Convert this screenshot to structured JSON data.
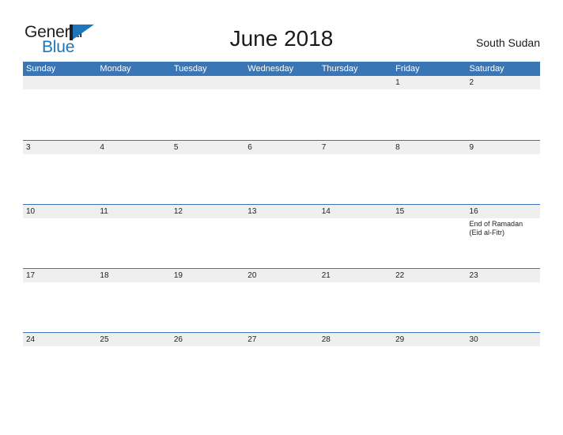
{
  "brand": {
    "name_part1": "General",
    "name_part2": "Blue",
    "triangle_color": "#1b76bc",
    "bar_color": "#231f20"
  },
  "header": {
    "title": "June 2018",
    "locale": "South Sudan"
  },
  "theme": {
    "header_blue": "#3a75b5",
    "date_strip_gray": "#efefef",
    "text_dark": "#222222",
    "page_background": "#ffffff"
  },
  "calendar": {
    "weekdays": [
      "Sunday",
      "Monday",
      "Tuesday",
      "Wednesday",
      "Thursday",
      "Friday",
      "Saturday"
    ],
    "weeks": [
      {
        "days": [
          {
            "num": "",
            "event": ""
          },
          {
            "num": "",
            "event": ""
          },
          {
            "num": "",
            "event": ""
          },
          {
            "num": "",
            "event": ""
          },
          {
            "num": "",
            "event": ""
          },
          {
            "num": "1",
            "event": ""
          },
          {
            "num": "2",
            "event": ""
          }
        ]
      },
      {
        "days": [
          {
            "num": "3",
            "event": ""
          },
          {
            "num": "4",
            "event": ""
          },
          {
            "num": "5",
            "event": ""
          },
          {
            "num": "6",
            "event": ""
          },
          {
            "num": "7",
            "event": ""
          },
          {
            "num": "8",
            "event": ""
          },
          {
            "num": "9",
            "event": ""
          }
        ]
      },
      {
        "days": [
          {
            "num": "10",
            "event": ""
          },
          {
            "num": "11",
            "event": ""
          },
          {
            "num": "12",
            "event": ""
          },
          {
            "num": "13",
            "event": ""
          },
          {
            "num": "14",
            "event": ""
          },
          {
            "num": "15",
            "event": ""
          },
          {
            "num": "16",
            "event": "End of Ramadan (Eid al-Fitr)"
          }
        ]
      },
      {
        "days": [
          {
            "num": "17",
            "event": ""
          },
          {
            "num": "18",
            "event": ""
          },
          {
            "num": "19",
            "event": ""
          },
          {
            "num": "20",
            "event": ""
          },
          {
            "num": "21",
            "event": ""
          },
          {
            "num": "22",
            "event": ""
          },
          {
            "num": "23",
            "event": ""
          }
        ]
      },
      {
        "days": [
          {
            "num": "24",
            "event": ""
          },
          {
            "num": "25",
            "event": ""
          },
          {
            "num": "26",
            "event": ""
          },
          {
            "num": "27",
            "event": ""
          },
          {
            "num": "28",
            "event": ""
          },
          {
            "num": "29",
            "event": ""
          },
          {
            "num": "30",
            "event": ""
          }
        ]
      }
    ]
  }
}
